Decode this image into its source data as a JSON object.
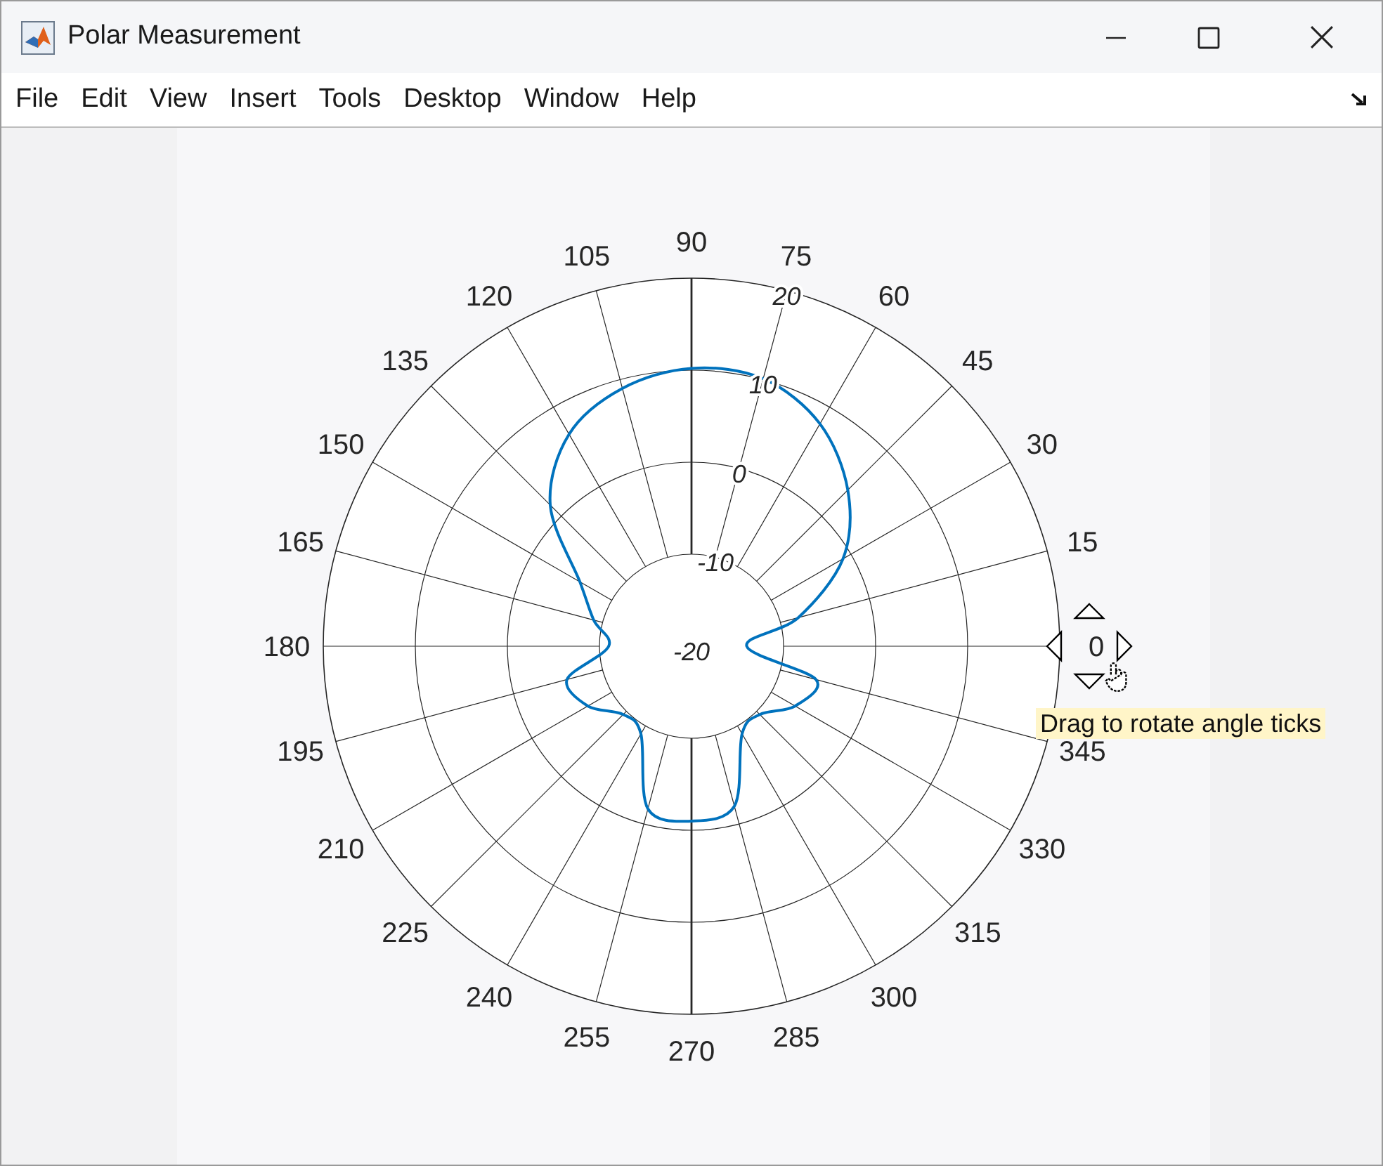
{
  "window": {
    "title": "Polar Measurement"
  },
  "menu": [
    "File",
    "Edit",
    "View",
    "Insert",
    "Tools",
    "Desktop",
    "Window",
    "Help"
  ],
  "plot": {
    "angle_labels": [
      "90",
      "105",
      "75",
      "120",
      "60",
      "135",
      "45",
      "150",
      "30",
      "165",
      "15",
      "180",
      "0",
      "195",
      "345",
      "210",
      "330",
      "225",
      "315",
      "240",
      "300",
      "255",
      "285",
      "270"
    ],
    "radius_labels": [
      "-20",
      "-10",
      "0",
      "10",
      "20"
    ]
  },
  "tooltip": "Drag to rotate angle ticks"
}
